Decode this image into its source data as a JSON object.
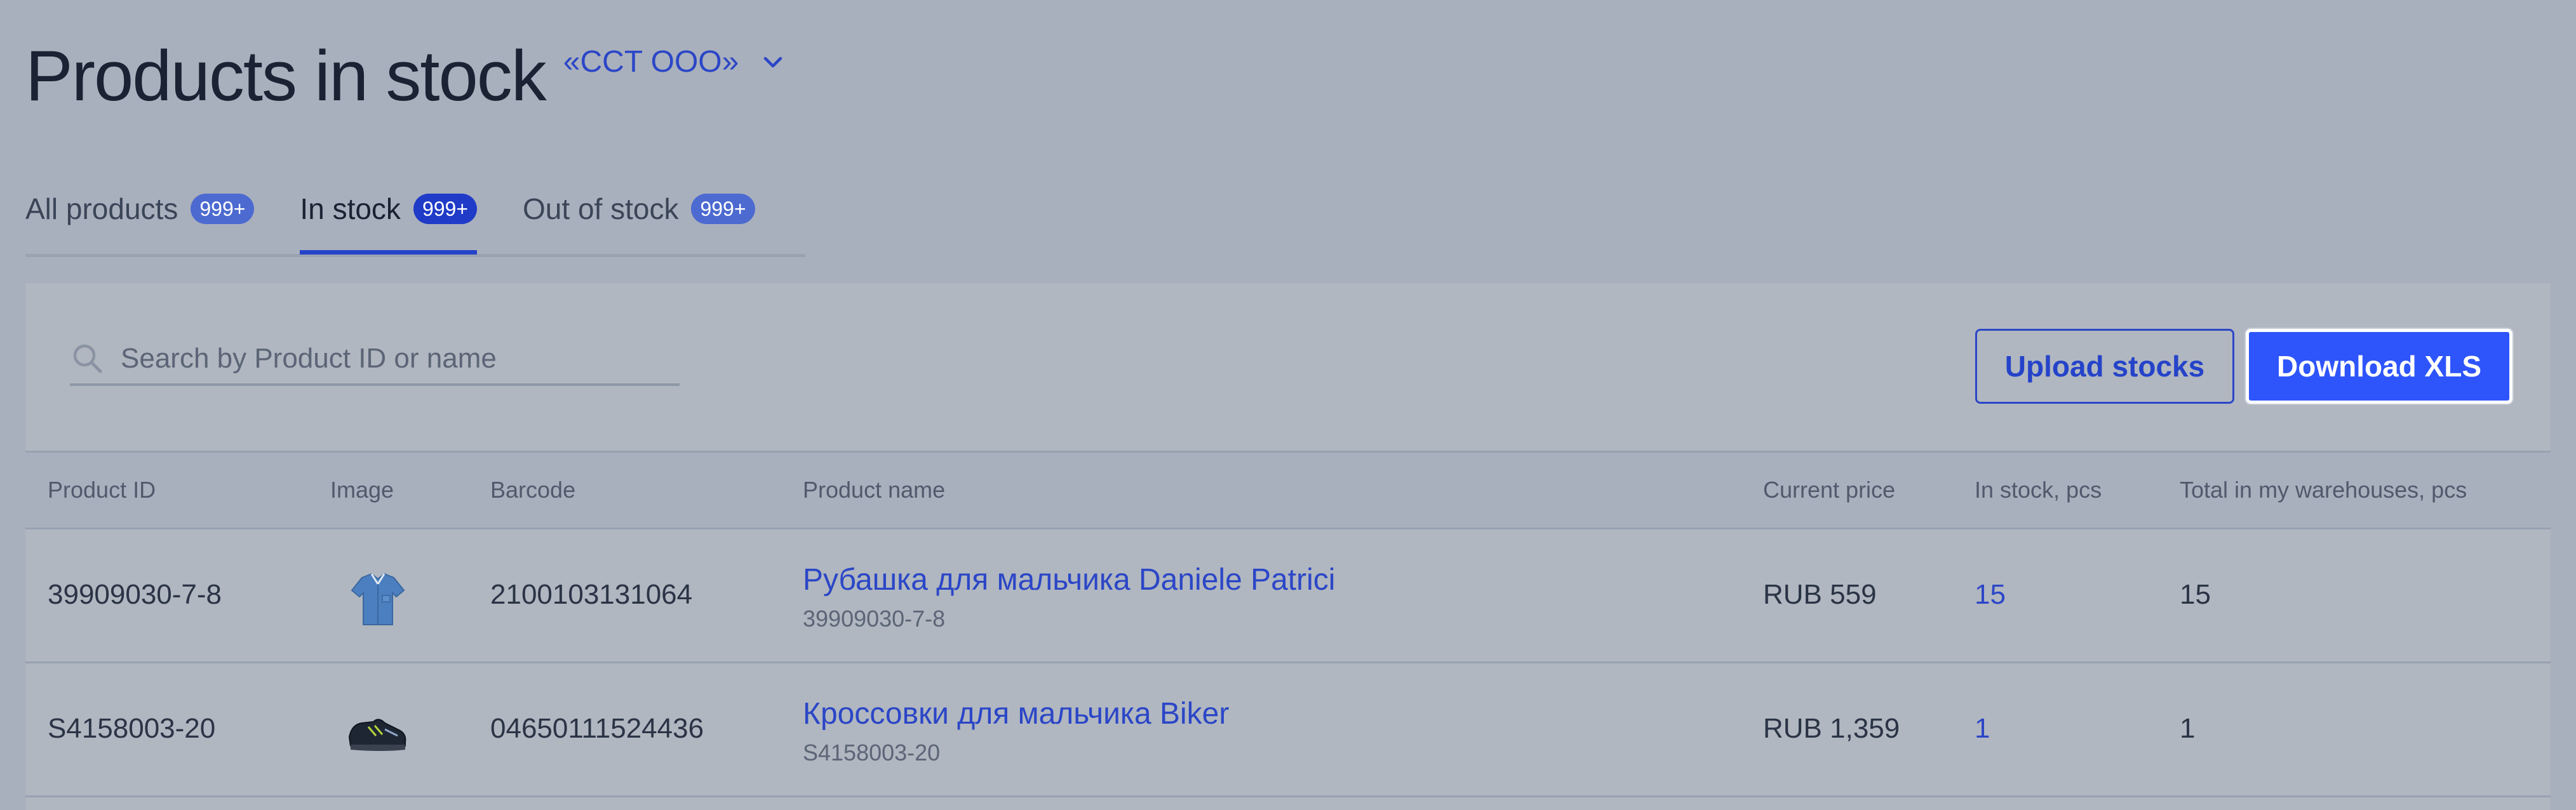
{
  "header": {
    "title": "Products in stock",
    "org_selector": "«CCT OOO»"
  },
  "tabs": [
    {
      "label": "All products",
      "badge": "999+",
      "active": false
    },
    {
      "label": "In stock",
      "badge": "999+",
      "active": true
    },
    {
      "label": "Out of stock",
      "badge": "999+",
      "active": false
    }
  ],
  "search": {
    "placeholder": "Search by Product ID or name",
    "value": ""
  },
  "actions": {
    "upload_label": "Upload stocks",
    "download_label": "Download XLS"
  },
  "table": {
    "columns": [
      "Product ID",
      "Image",
      "Barcode",
      "Product name",
      "Current price",
      "In stock, pcs",
      "Total in my warehouses, pcs"
    ],
    "rows": [
      {
        "product_id": "39909030-7-8",
        "image": "shirt-thumbnail",
        "barcode": "2100103131064",
        "name": "Рубашка для мальчика Daniele Patrici",
        "sub_id": "39909030-7-8",
        "price": "RUB 559",
        "in_stock": "15",
        "total": "15"
      },
      {
        "product_id": "S4158003-20",
        "image": "sneaker-thumbnail",
        "barcode": "04650111524436",
        "name": "Кроссовки для мальчика Biker",
        "sub_id": "S4158003-20",
        "price": "RUB 1,359",
        "in_stock": "1",
        "total": "1"
      }
    ]
  },
  "colors": {
    "accent": "#2e55fb",
    "link": "#2b46c7",
    "overlay_bg": "#a9b0bd"
  }
}
